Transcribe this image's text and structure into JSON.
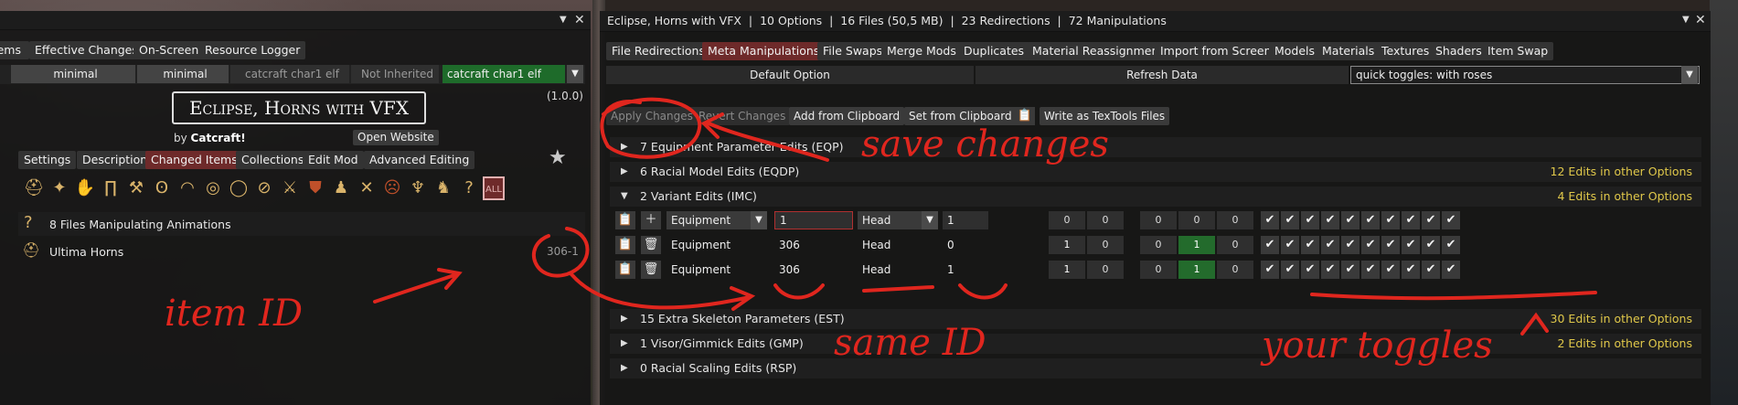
{
  "colors": {
    "accent_red": "#6e2a2a",
    "info_yellow": "#e0c84a",
    "annotation_red": "#e0261e",
    "check_green": "#236b2c"
  },
  "left": {
    "window_close": "✕",
    "window_collapse": "▼",
    "tabs": [
      "Items",
      "Effective Changes",
      "On-Screen",
      "Resource Logger"
    ],
    "collection_bar": [
      "minimal",
      "minimal",
      "catcraft char1 elf",
      "Not Inherited",
      "catcraft char1 elf"
    ],
    "mod_title": "Eclipse, Horns with VFX",
    "version": "(1.0.0)",
    "by_prefix": "by",
    "author": "Catcraft!",
    "open_website": "Open Website",
    "mod_tabs": [
      "Settings",
      "Description",
      "Changed Items",
      "Collections",
      "Edit Mod",
      "Advanced Editing"
    ],
    "all_button": "ALL",
    "list_items": [
      {
        "icon": "?",
        "label": "8 Files Manipulating Animations",
        "id": ""
      },
      {
        "icon": "horn",
        "label": "Ultima Horns",
        "id": "306-1"
      }
    ]
  },
  "right": {
    "title": "Eclipse, Horns with VFX  |  10 Options  |  16 Files (50,5 MB)  |  23 Redirections  |  72 Manipulations",
    "window_close": "✕",
    "window_collapse": "▼",
    "tabs": [
      "File Redirections",
      "Meta Manipulations",
      "File Swaps",
      "Merge Mods",
      "Duplicates",
      "Material Reassignment",
      "Import from Screen",
      "Models",
      "Materials",
      "Textures",
      "Shaders",
      "Item Swap"
    ],
    "default_option": "Default Option",
    "refresh_data": "Refresh Data",
    "option_select": "quick toggles: with roses",
    "actions": [
      "Apply Changes",
      "Revert Changes",
      "Add from Clipboard",
      "Set from Clipboard",
      "Write as TexTools Files"
    ],
    "sections_top": [
      {
        "label": "7 Equipment Parameter Edits (EQP)",
        "extra": "",
        "open": false
      },
      {
        "label": "6 Racial Model Edits (EQDP)",
        "extra": "12 Edits in other Options",
        "open": false
      },
      {
        "label": "2 Variant Edits (IMC)",
        "extra": "4 Edits in other Options",
        "open": true
      }
    ],
    "imc_rows": [
      {
        "type": "Equipment",
        "id": "1",
        "slot": "Head",
        "variant": "1",
        "nums": [
          "0",
          "0",
          "0",
          "0",
          "0"
        ],
        "checks": 10,
        "editable": true
      },
      {
        "type": "Equipment",
        "id": "306",
        "slot": "Head",
        "variant": "0",
        "nums": [
          "1",
          "0",
          "0",
          "1",
          "0"
        ],
        "checks": 10,
        "editable": false
      },
      {
        "type": "Equipment",
        "id": "306",
        "slot": "Head",
        "variant": "1",
        "nums": [
          "1",
          "0",
          "0",
          "1",
          "0"
        ],
        "checks": 10,
        "editable": false
      }
    ],
    "sections_bottom": [
      {
        "label": "15 Extra Skeleton Parameters (EST)",
        "extra": "30 Edits in other Options"
      },
      {
        "label": "1 Visor/Gimmick Edits (GMP)",
        "extra": "2 Edits in other Options"
      },
      {
        "label": "0 Racial Scaling Edits (RSP)",
        "extra": ""
      }
    ]
  },
  "annotations": [
    "save changes",
    "item ID",
    "same ID",
    "your toggles"
  ]
}
